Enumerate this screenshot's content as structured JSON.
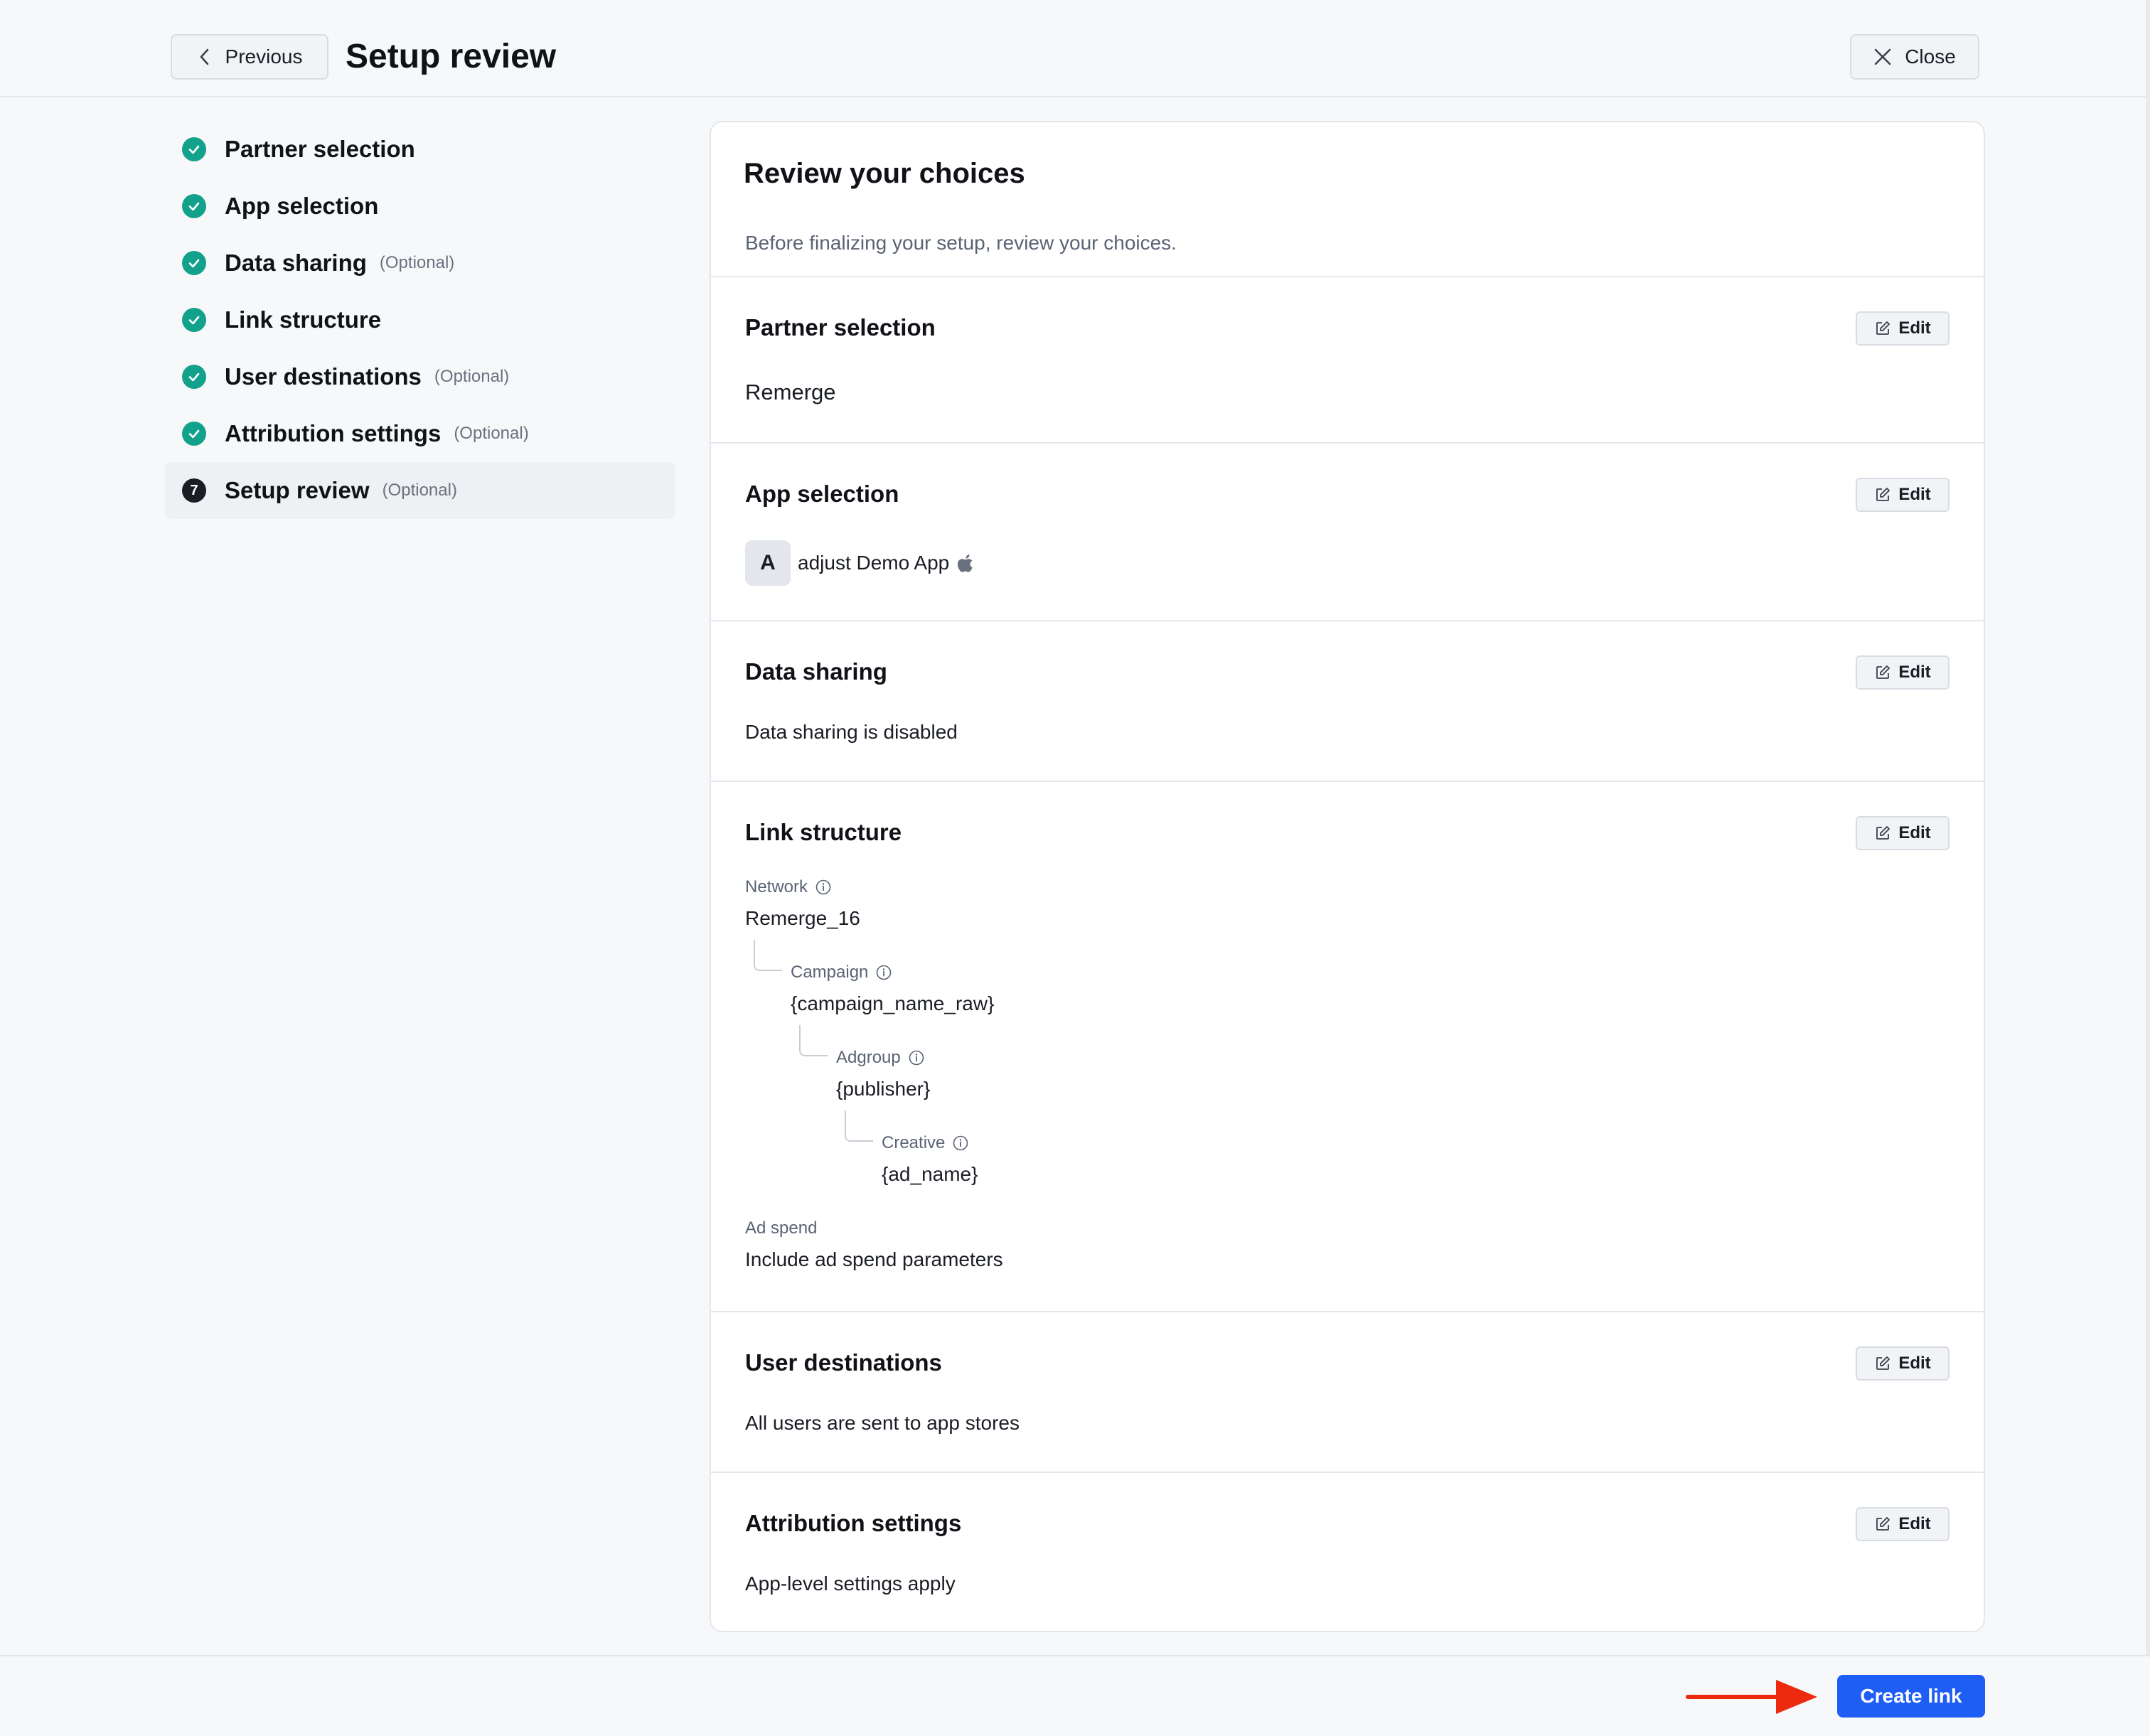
{
  "header": {
    "previous_label": "Previous",
    "title": "Setup review",
    "close_label": "Close"
  },
  "steps": [
    {
      "label": "Partner selection",
      "optional": "",
      "state": "done"
    },
    {
      "label": "App selection",
      "optional": "",
      "state": "done"
    },
    {
      "label": "Data sharing",
      "optional": "(Optional)",
      "state": "done"
    },
    {
      "label": "Link structure",
      "optional": "",
      "state": "done"
    },
    {
      "label": "User destinations",
      "optional": "(Optional)",
      "state": "done"
    },
    {
      "label": "Attribution settings",
      "optional": "(Optional)",
      "state": "done"
    },
    {
      "label": "Setup review",
      "optional": "(Optional)",
      "state": "current",
      "number": "7"
    }
  ],
  "review": {
    "title": "Review your choices",
    "subtitle": "Before finalizing your setup, review your choices.",
    "edit_label": "Edit",
    "partner": {
      "title": "Partner selection",
      "value": "Remerge"
    },
    "app": {
      "title": "App selection",
      "avatar_letter": "A",
      "name": "adjust Demo App",
      "platform_icon": "apple-icon"
    },
    "data_sharing": {
      "title": "Data sharing",
      "value": "Data sharing is disabled"
    },
    "link_structure": {
      "title": "Link structure",
      "network_label": "Network",
      "network_value": "Remerge_16",
      "campaign_label": "Campaign",
      "campaign_value": "{campaign_name_raw}",
      "adgroup_label": "Adgroup",
      "adgroup_value": "{publisher}",
      "creative_label": "Creative",
      "creative_value": "{ad_name}",
      "adspend_label": "Ad spend",
      "adspend_value": "Include ad spend parameters"
    },
    "user_destinations": {
      "title": "User destinations",
      "value": "All users are sent to app stores"
    },
    "attribution": {
      "title": "Attribution settings",
      "value": "App-level settings apply"
    }
  },
  "footer": {
    "create_label": "Create link"
  },
  "colors": {
    "accent": "#1e5ef5",
    "done": "#12a28c",
    "annotation_arrow": "#ee2a0e"
  }
}
